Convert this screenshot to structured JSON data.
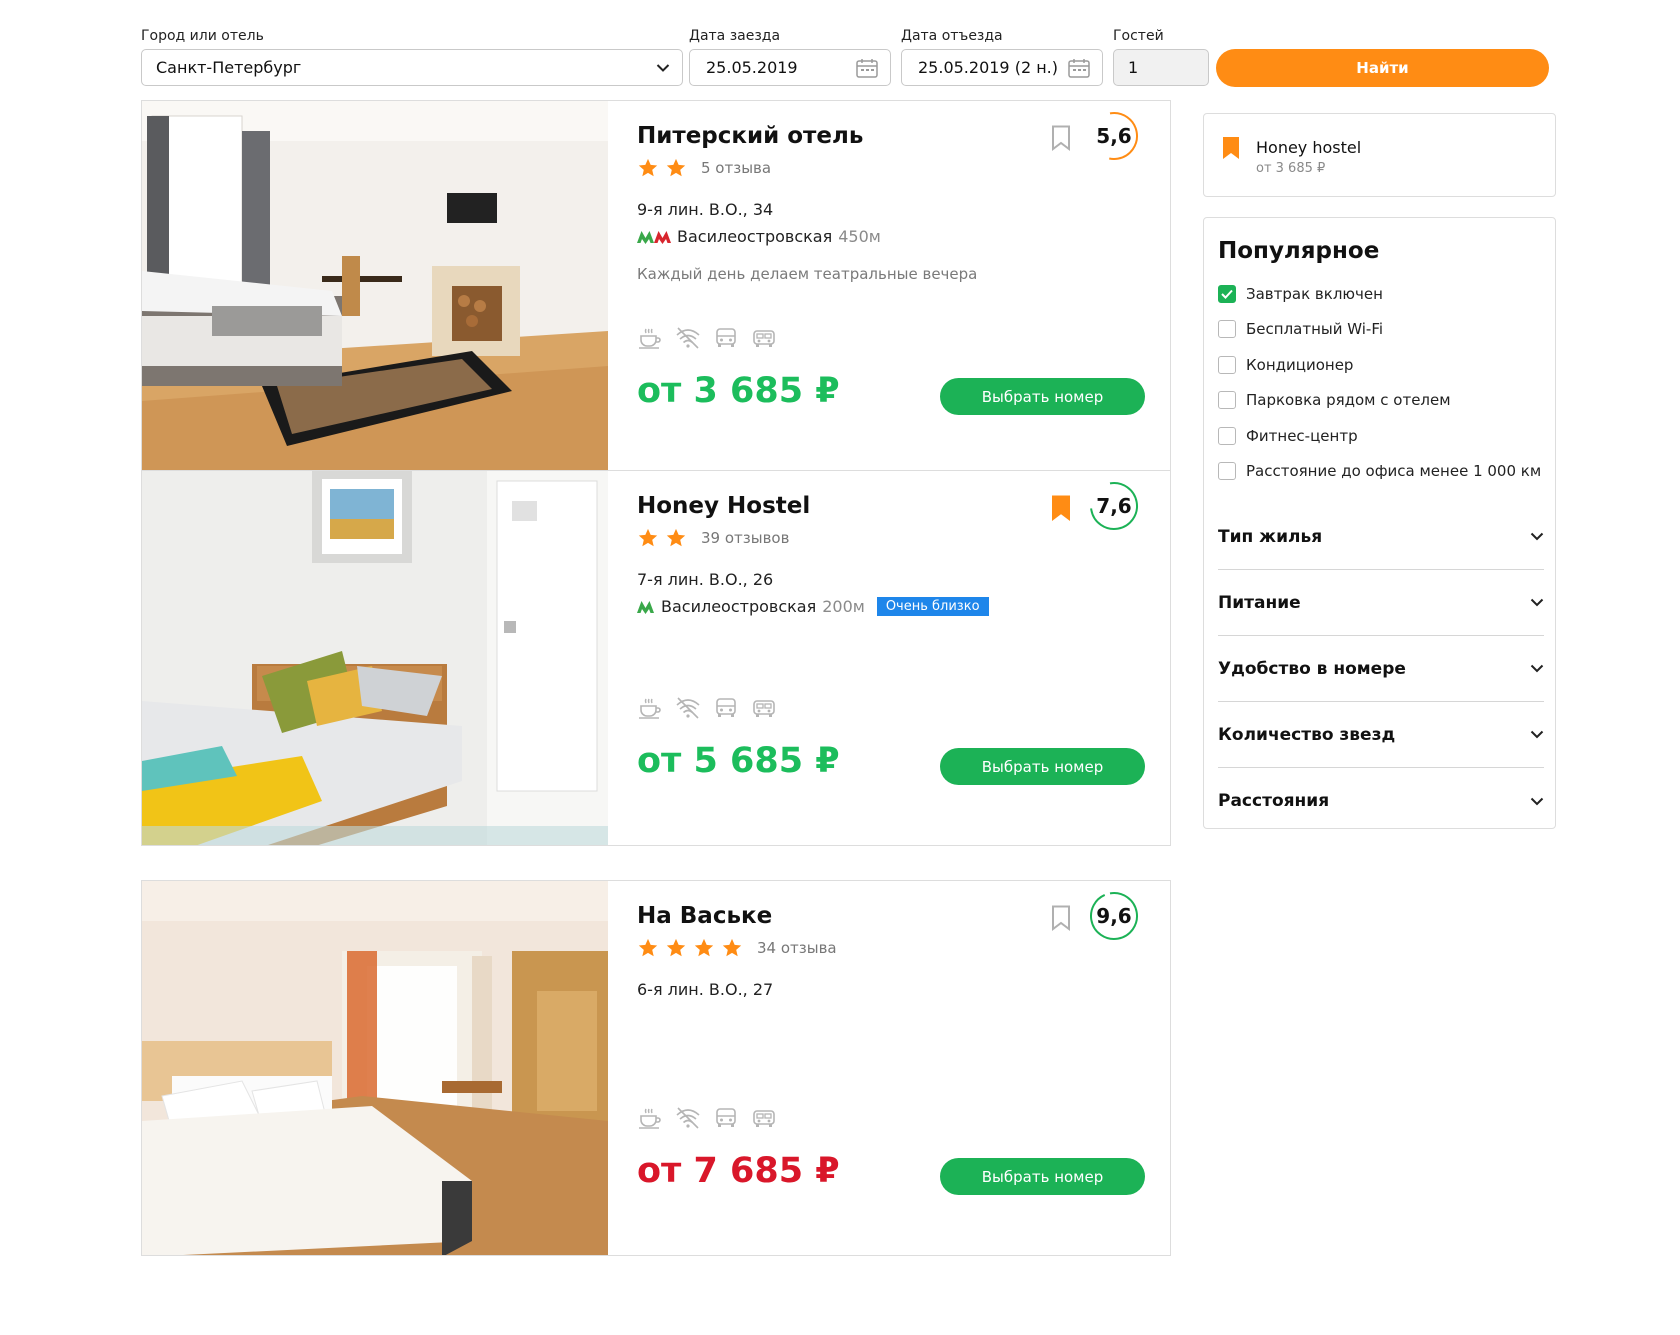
{
  "search": {
    "city_label": "Город или отель",
    "city_value": "Санкт-Петербург",
    "checkin_label": "Дата заезда",
    "checkin_value": "25.05.2019",
    "checkout_label": "Дата отъезда",
    "checkout_value": "25.05.2019 (2 н.)",
    "guests_label": "Гостей",
    "guests_value": "1",
    "find_label": "Найти"
  },
  "colors": {
    "accent_orange": "#ff8c14",
    "green": "#1cb256",
    "price_green": "#1cbd5c",
    "price_red": "#d9172a",
    "badge_blue": "#1e86ea",
    "metro_green": "#3aa84a",
    "metro_red": "#d8262e"
  },
  "hotels": [
    {
      "name": "Питерский отель",
      "stars": 2,
      "reviews": "5 отзыва",
      "address": "9-я лин. В.О., 34",
      "metro": "Василеостровская",
      "metro_distance": "450м",
      "badge": "",
      "description": "Каждый день делаем театральные вечера",
      "price": "от 3 685 ₽",
      "choose_label": "Выбрать номер",
      "rating": "5,6",
      "rating_fraction": 0.56,
      "saved": false
    },
    {
      "name": "Honey Hostel",
      "stars": 2,
      "reviews": "39 отзывов",
      "address": "7-я лин. В.О., 26",
      "metro": "Василеостровская",
      "metro_distance": "200м",
      "badge": "Очень близко",
      "description": "",
      "price": "от 5 685 ₽",
      "choose_label": "Выбрать номер",
      "rating": "7,6",
      "rating_fraction": 0.76,
      "saved": true
    },
    {
      "name": "На Ваське",
      "stars": 4,
      "reviews": "34 отзыва",
      "address": "6-я лин. В.О., 27",
      "metro": "",
      "metro_distance": "",
      "badge": "",
      "description": "",
      "price": "от 7 685 ₽",
      "choose_label": "Выбрать номер",
      "rating": "9,6",
      "rating_fraction": 0.96,
      "saved": false
    }
  ],
  "amenity_icons": [
    "coffee-icon",
    "no-wifi-icon",
    "car-icon",
    "bus-icon"
  ],
  "favorites": {
    "name": "Honey hostel",
    "price": "от 3 685 ₽"
  },
  "filters": {
    "title": "Популярное",
    "options": [
      {
        "label": "Завтрак включен",
        "checked": true
      },
      {
        "label": "Бесплатный Wi-Fi",
        "checked": false
      },
      {
        "label": "Кондиционер",
        "checked": false
      },
      {
        "label": "Парковка рядом с отелем",
        "checked": false
      },
      {
        "label": "Фитнес-центр",
        "checked": false
      },
      {
        "label": "Расстояние до офиса менее 1 000 км",
        "checked": false
      }
    ],
    "sections": [
      "Тип жилья",
      "Питание",
      "Удобство в номере",
      "Количество звезд",
      "Расстояния"
    ]
  }
}
